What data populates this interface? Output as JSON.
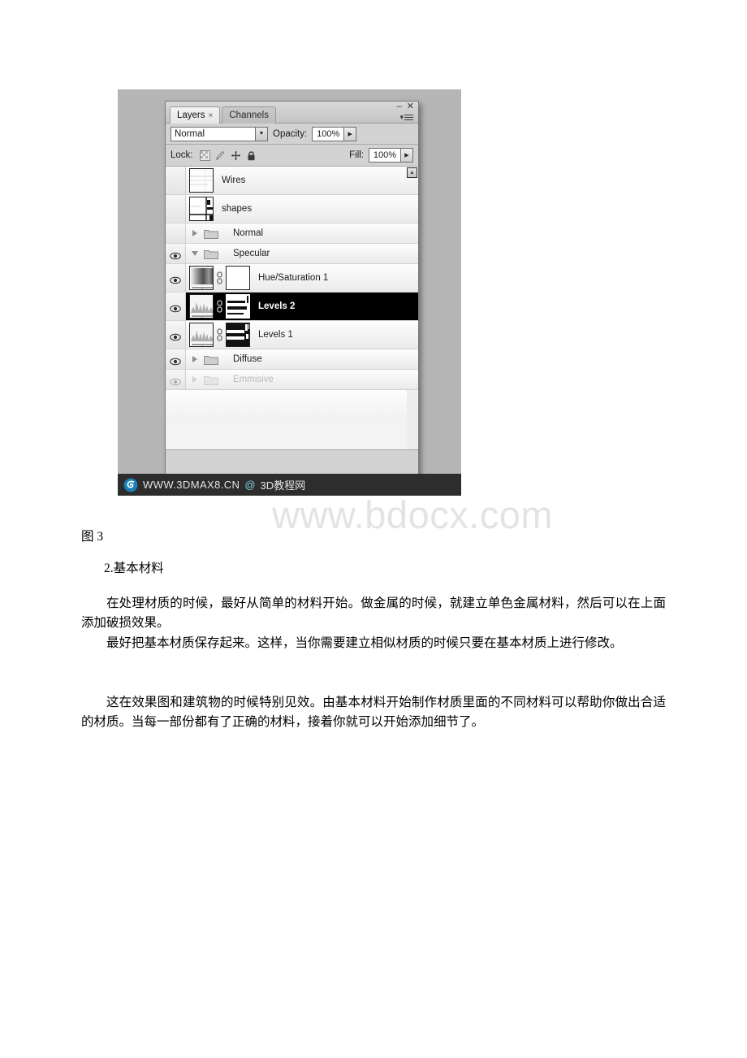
{
  "figure": {
    "watermark_strip": {
      "site": "WWW.3DMAX8.CN",
      "at": "@",
      "site_cn": "3D教程网",
      "logo_icon": "spiral-logo-icon"
    },
    "panel": {
      "tabs": [
        {
          "label": "Layers",
          "close_glyph": "×",
          "active": true
        },
        {
          "label": "Channels",
          "close_glyph": "",
          "active": false
        }
      ],
      "window_buttons": {
        "minimize": "–",
        "close": "✕"
      },
      "menu_icon": "panel-menu-icon",
      "blend": {
        "mode": "Normal",
        "opacity_label": "Opacity:",
        "opacity_value": "100%"
      },
      "lock": {
        "label": "Lock:",
        "icons": [
          "lock-transparent-pixels-icon",
          "lock-image-pixels-icon",
          "lock-position-icon",
          "lock-all-icon"
        ],
        "fill_label": "Fill:",
        "fill_value": "100%"
      },
      "scroll_up_glyph": "▲",
      "layers": [
        {
          "name": "Wires",
          "type": "raster",
          "visible": false,
          "kind": "layer",
          "selected": false,
          "dim": false
        },
        {
          "name": "shapes",
          "type": "raster",
          "visible": false,
          "kind": "layer",
          "selected": false,
          "dim": false
        },
        {
          "name": "Normal",
          "type": "group",
          "visible": false,
          "kind": "group",
          "expanded": false,
          "selected": false,
          "dim": false
        },
        {
          "name": "Specular",
          "type": "group",
          "visible": true,
          "kind": "group",
          "expanded": true,
          "selected": false,
          "dim": false
        },
        {
          "name": "Hue/Saturation 1",
          "type": "adjustment",
          "visible": true,
          "kind": "adjust",
          "selected": false,
          "dim": false,
          "mask": "white"
        },
        {
          "name": "Levels 2",
          "type": "adjustment",
          "visible": true,
          "kind": "adjust",
          "selected": true,
          "dim": false,
          "mask": "mixed"
        },
        {
          "name": "Levels 1",
          "type": "adjustment",
          "visible": true,
          "kind": "adjust",
          "selected": false,
          "dim": false,
          "mask": "dark"
        },
        {
          "name": "Diffuse",
          "type": "group",
          "visible": true,
          "kind": "group",
          "expanded": false,
          "selected": false,
          "dim": false
        },
        {
          "name": "Emmisive",
          "type": "group",
          "visible": true,
          "kind": "group",
          "expanded": false,
          "selected": false,
          "dim": true
        }
      ]
    }
  },
  "page": {
    "watermark": "www.bdocx.com",
    "caption": "图 3",
    "heading": "2.基本材料",
    "paragraphs": [
      "在处理材质的时候，最好从简单的材料开始。做金属的时候，就建立单色金属材料，然后可以在上面添加破损效果。",
      "最好把基本材质保存起来。这样，当你需要建立相似材质的时候只要在基本材质上进行修改。",
      "这在效果图和建筑物的时候特别见效。由基本材料开始制作材质里面的不同材料可以帮助你做出合适的材质。当每一部份都有了正确的材料，接着你就可以开始添加细节了。"
    ]
  }
}
